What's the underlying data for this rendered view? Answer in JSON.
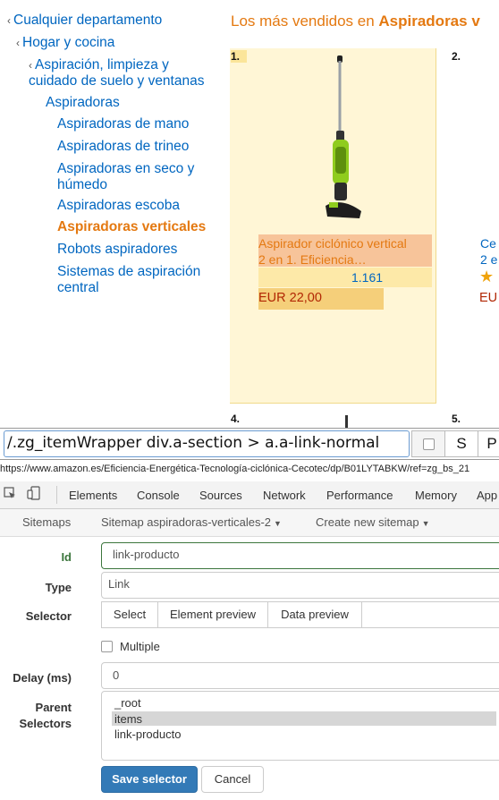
{
  "categories": [
    {
      "label": "Cualquier departamento",
      "chevron": "‹"
    },
    {
      "label": "Hogar y cocina",
      "chevron": "‹"
    },
    {
      "label": "Aspiración, limpieza y",
      "label2": "cuidado de suelo y ventanas",
      "chevron": "‹"
    },
    {
      "label": "Aspiradoras"
    },
    {
      "label": "Aspiradoras de mano"
    },
    {
      "label": "Aspiradoras de trineo"
    },
    {
      "label": "Aspiradoras en seco y",
      "label2": "húmedo"
    },
    {
      "label": "Aspiradoras escoba"
    },
    {
      "label": "Aspiradoras verticales",
      "selected": true
    },
    {
      "label": "Robots aspiradores"
    },
    {
      "label": "Sistemas de aspiración",
      "label2": "central"
    }
  ],
  "bestsellers": {
    "title_prefix": "Los más vendidos en ",
    "title_bold": "Aspiradoras v",
    "products": [
      {
        "rank": "1.",
        "name_line1": "Aspirador ciclónico vertical",
        "name_line2": "2 en 1. Eficiencia…",
        "reviews": "1.161",
        "price": "EUR 22,00"
      },
      {
        "rank": "2.",
        "name_line1": "Ce",
        "name_line2": "2 e",
        "price": "EU"
      }
    ],
    "rank4": "4.",
    "rank5": "5."
  },
  "selector_bar": {
    "value": "/.zg_itemWrapper div.a-section > a.a-link-normal",
    "btn_s": "S",
    "btn_p": "P"
  },
  "url": "https://www.amazon.es/Eficiencia-Energética-Tecnología-ciclónica-Cecotec/dp/B01LYTABKW/ref=zg_bs_21",
  "devtools": {
    "tabs": [
      "Elements",
      "Console",
      "Sources",
      "Network",
      "Performance",
      "Memory",
      "App"
    ]
  },
  "sitemap_menu": {
    "sitemaps": "Sitemaps",
    "current": "Sitemap aspiradoras-verticales-2",
    "create": "Create new sitemap"
  },
  "form": {
    "id_label": "Id",
    "id_value": "link-producto",
    "type_label": "Type",
    "type_value": "Link",
    "selector_label": "Selector",
    "selector_buttons": [
      "Select",
      "Element preview",
      "Data preview"
    ],
    "multiple_label": "Multiple",
    "delay_label": "Delay (ms)",
    "delay_value": "0",
    "parent_label_1": "Parent",
    "parent_label_2": "Selectors",
    "parent_selectors": [
      "_root",
      "items",
      "link-producto"
    ],
    "parent_selected": "items",
    "save_label": "Save selector",
    "cancel_label": "Cancel"
  },
  "colors": {
    "amazon_link": "#0066c0",
    "amazon_orange": "#e47911",
    "price_red": "#b12704",
    "primary_button": "#337ab7"
  }
}
